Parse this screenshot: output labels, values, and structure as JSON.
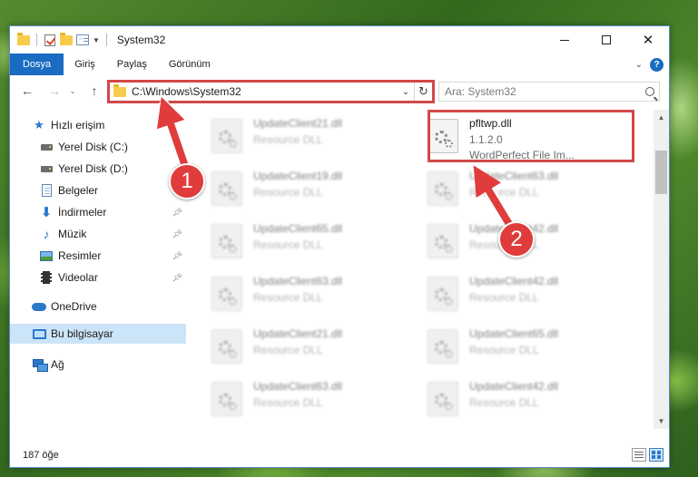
{
  "window": {
    "title": "System32"
  },
  "ribbon": {
    "tabs": [
      "Dosya",
      "Giriş",
      "Paylaş",
      "Görünüm"
    ],
    "help": "?"
  },
  "address_bar": {
    "path": "C:\\Windows\\System32"
  },
  "search": {
    "placeholder": "Ara: System32"
  },
  "sidebar": {
    "items": [
      {
        "label": "Hızlı erişim",
        "icon": "star-icon"
      },
      {
        "label": "Yerel Disk (C:)",
        "icon": "drive-icon"
      },
      {
        "label": "Yerel Disk (D:)",
        "icon": "drive-icon"
      },
      {
        "label": "Belgeler",
        "icon": "document-icon"
      },
      {
        "label": "İndirmeler",
        "icon": "download-icon"
      },
      {
        "label": "Müzik",
        "icon": "music-icon"
      },
      {
        "label": "Resimler",
        "icon": "picture-icon"
      },
      {
        "label": "Videolar",
        "icon": "video-icon"
      },
      {
        "label": "OneDrive",
        "icon": "cloud-icon"
      },
      {
        "label": "Bu bilgisayar",
        "icon": "computer-icon"
      },
      {
        "label": "Ağ",
        "icon": "network-icon"
      }
    ],
    "selected": "Bu bilgisayar"
  },
  "files": {
    "left_column": [
      {
        "name": "UpdateClient21.dll",
        "type": "Resource DLL"
      },
      {
        "name": "UpdateClient19.dll",
        "type": "Resource DLL"
      },
      {
        "name": "UpdateClient65.dll",
        "type": "Resource DLL"
      },
      {
        "name": "UpdateClient63.dll",
        "type": "Resource DLL"
      },
      {
        "name": "UpdateClient21.dll",
        "type": "Resource DLL"
      },
      {
        "name": "UpdateClient63.dll",
        "type": "Resource DLL"
      }
    ],
    "right_column": [
      {
        "name": "UpdateClient63.dll",
        "type": "Resource DLL"
      },
      {
        "name": "UpdateClient42.dll",
        "type": "Resource DLL"
      },
      {
        "name": "UpdateClient42.dll",
        "type": "Resource DLL"
      },
      {
        "name": "UpdateClient65.dll",
        "type": "Resource DLL"
      },
      {
        "name": "UpdateClient42.dll",
        "type": "Resource DLL"
      }
    ],
    "highlighted": {
      "name": "pfltwp.dll",
      "version": "1.1.2.0",
      "description": "WordPerfect File Im..."
    }
  },
  "status": {
    "item_count": "187 öğe"
  },
  "annotations": {
    "badge_1": "1",
    "badge_2": "2",
    "color": "#e03c3c"
  },
  "colors": {
    "accent": "#1a6cc2",
    "selection": "#cce4f7",
    "highlight_frame": "#d24848"
  }
}
